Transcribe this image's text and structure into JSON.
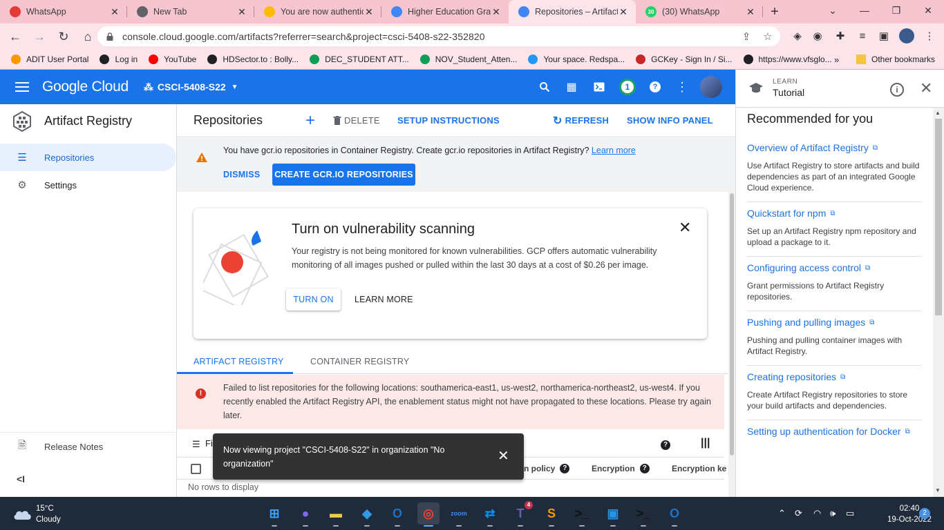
{
  "browser": {
    "tabs": [
      {
        "title": "WhatsApp",
        "color": "#e53935",
        "icon": "whatsapp-alert-icon"
      },
      {
        "title": "New Tab",
        "color": "#5f6368",
        "icon": "chrome-icon"
      },
      {
        "title": "You are now authentic",
        "color": "#fbbc04",
        "icon": "google-cloud-icon"
      },
      {
        "title": "Higher Education Gra",
        "color": "#4285f4",
        "icon": "chrome-web-icon"
      },
      {
        "title": "Repositories – Artifact",
        "color": "#4285f4",
        "icon": "artifact-registry-icon"
      },
      {
        "title": "(30) WhatsApp",
        "color": "#25d366",
        "icon": "whatsapp-icon",
        "badge": "30"
      }
    ],
    "url": "console.cloud.google.com/artifacts?referrer=search&project=csci-5408-s22-352820",
    "bookmarks": [
      {
        "label": "ADIT User Portal",
        "color": "#ff9800"
      },
      {
        "label": "Log in",
        "color": "#202124"
      },
      {
        "label": "YouTube",
        "color": "#ff0000"
      },
      {
        "label": "HDSector.to : Bolly...",
        "color": "#202124"
      },
      {
        "label": "DEC_STUDENT ATT...",
        "color": "#0f9d58"
      },
      {
        "label": "NOV_Student_Atten...",
        "color": "#0f9d58"
      },
      {
        "label": "Your space. Redspa...",
        "color": "#2196f3"
      },
      {
        "label": "GCKey - Sign In / Si...",
        "color": "#c62828"
      },
      {
        "label": "https://www.vfsglo...",
        "color": "#202124"
      }
    ],
    "bookmarks_more": "»",
    "other_bookmarks": "Other bookmarks"
  },
  "gcp_header": {
    "logo_google": "Google",
    "logo_cloud": " Cloud",
    "project": "CSCI-5408-S22",
    "notification_count": "1"
  },
  "sidebar": {
    "product": "Artifact Registry",
    "items": [
      {
        "label": "Repositories",
        "active": true
      },
      {
        "label": "Settings",
        "active": false
      }
    ],
    "release_notes": "Release Notes",
    "collapse": "<I"
  },
  "toolbar": {
    "title": "Repositories",
    "delete": "DELETE",
    "setup": "SETUP INSTRUCTIONS",
    "refresh": "REFRESH",
    "info_panel": "SHOW INFO PANEL"
  },
  "banner": {
    "text": "You have gcr.io repositories in Container Registry. ",
    "bold": "Create gcr.io repositories in Artifact Registry?",
    "link": "Learn more",
    "dismiss": "DISMISS",
    "create": "CREATE GCR.IO REPOSITORIES"
  },
  "vuln_card": {
    "title": "Turn on vulnerability scanning",
    "description": "Your registry is not being monitored for known vulnerabilities. GCP offers automatic vulnerability monitoring of all images pushed or pulled within the last 30 days at a cost of $0.26 per image.",
    "turn_on": "TURN ON",
    "learn_more": "LEARN MORE"
  },
  "registry_tabs": [
    "ARTIFACT REGISTRY",
    "CONTAINER REGISTRY"
  ],
  "error": "Failed to list repositories for the following locations: southamerica-east1, us-west2, northamerica-northeast2, us-west4. If you recently enabled the Artifact Registry API, the enablement status might not have propagated to these locations. Please try again later.",
  "filter": {
    "label": "Fi"
  },
  "table": {
    "columns": [
      "n policy",
      "Encryption",
      "Encryption ke"
    ],
    "empty": "No rows to display"
  },
  "toast": {
    "message": "Now viewing project \"CSCI-5408-S22\" in organization \"No organization\""
  },
  "tutorial": {
    "caption": "LEARN",
    "title": "Tutorial",
    "recommended": "Recommended for you",
    "items": [
      {
        "link": "Overview of Artifact Registry",
        "desc": "Use Artifact Registry to store artifacts and build dependencies as part of an integrated Google Cloud experience."
      },
      {
        "link": "Quickstart for npm",
        "desc": "Set up an Artifact Registry npm repository and upload a package to it."
      },
      {
        "link": "Configuring access control",
        "desc": "Grant permissions to Artifact Registry repositories."
      },
      {
        "link": "Pushing and pulling images",
        "desc": "Pushing and pulling container images with Artifact Registry."
      },
      {
        "link": "Creating repositories",
        "desc": "Create Artifact Registry repositories to store your build artifacts and dependencies."
      },
      {
        "link": "Setting up authentication for Docker",
        "desc": ""
      }
    ]
  },
  "taskbar": {
    "temperature": "15°C",
    "weather": "Cloudy",
    "time": "02:40",
    "date": "19-Oct-2022",
    "notifications": "2",
    "apps": [
      {
        "name": "windows-start",
        "glyph": "⊞",
        "color": "#3aa0ff"
      },
      {
        "name": "video-chat",
        "glyph": "●",
        "color": "#7b68ee"
      },
      {
        "name": "file-explorer",
        "glyph": "▬",
        "color": "#f2c94c"
      },
      {
        "name": "vscode",
        "glyph": "◆",
        "color": "#2f9be8"
      },
      {
        "name": "outlook",
        "glyph": "O",
        "color": "#1b73c7"
      },
      {
        "name": "chrome",
        "glyph": "◎",
        "color": "#ea4335"
      },
      {
        "name": "zoom",
        "glyph": "zoom",
        "color": "#2d8cff"
      },
      {
        "name": "teamviewer",
        "glyph": "⇄",
        "color": "#0e8ee9"
      },
      {
        "name": "teams",
        "glyph": "T",
        "color": "#6264a7",
        "badge": "4"
      },
      {
        "name": "sublime",
        "glyph": "S",
        "color": "#ff9800"
      },
      {
        "name": "terminal",
        "glyph": ">_",
        "color": "#111"
      },
      {
        "name": "docker",
        "glyph": "▣",
        "color": "#2496ed"
      },
      {
        "name": "terminal-2",
        "glyph": ">_",
        "color": "#111"
      },
      {
        "name": "outlook-2",
        "glyph": "O",
        "color": "#1b73c7"
      }
    ]
  }
}
